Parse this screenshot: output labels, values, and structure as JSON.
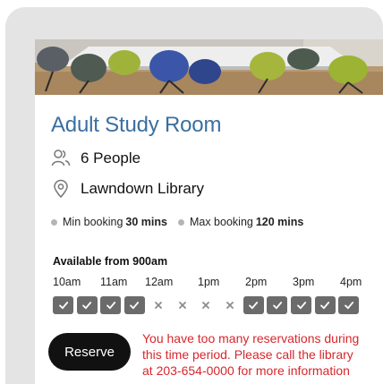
{
  "room": {
    "title": "Adult Study Room",
    "capacity": "6 People",
    "location": "Lawndown Library"
  },
  "booking_rules": {
    "min_label": "Min booking",
    "min_value": "30 mins",
    "max_label": "Max booking",
    "max_value": "120 mins"
  },
  "availability": {
    "heading": "Available from 900am",
    "time_labels": [
      "10am",
      "11am",
      "12am",
      "1pm",
      "2pm",
      "3pm",
      "4pm"
    ],
    "slots": [
      "available",
      "available",
      "available",
      "available",
      "unavailable",
      "unavailable",
      "unavailable",
      "unavailable",
      "available",
      "available",
      "available",
      "available",
      "available"
    ]
  },
  "actions": {
    "reserve_label": "Reserve"
  },
  "error": {
    "lines": [
      "You have too many reservations during",
      "this time  period.  Please call the library",
      "at 203-654-0000  for more information"
    ]
  },
  "colors": {
    "title": "#3a6fa0",
    "error": "#d8262b",
    "slot_available": "#6b6b6b",
    "reserve_bg": "#111111"
  },
  "icons": {
    "capacity": "people-icon",
    "location": "map-pin-icon",
    "available": "checkmark-icon",
    "unavailable": "x-icon"
  }
}
